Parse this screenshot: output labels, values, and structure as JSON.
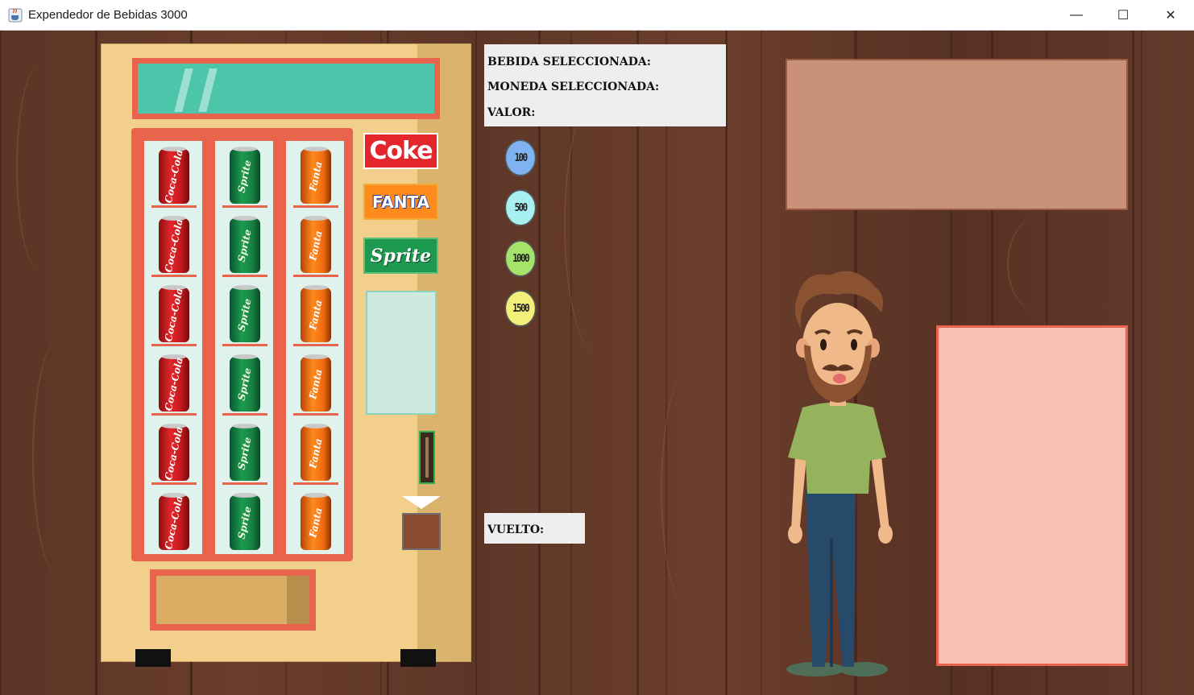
{
  "window": {
    "title": "Expendedor de Bebidas 3000",
    "controls": {
      "minimize": "—",
      "maximize": "☐",
      "close": "✕"
    }
  },
  "machine": {
    "columns": [
      {
        "brand": "coke",
        "can_label": "Coca-Cola",
        "count": 6
      },
      {
        "brand": "sprite",
        "can_label": "Sprite",
        "count": 6
      },
      {
        "brand": "fanta",
        "can_label": "Fanta",
        "count": 6
      }
    ],
    "brand_buttons": [
      {
        "key": "coke",
        "label": "Coke"
      },
      {
        "key": "fanta",
        "label": "FANTA"
      },
      {
        "key": "sprite",
        "label": "Sprite"
      }
    ]
  },
  "info": {
    "bebida_label": "BEBIDA SELECCIONADA:",
    "moneda_label": "MONEDA SELECCIONADA:",
    "valor_label": "VALOR:",
    "vuelto_label": "VUELTO:"
  },
  "coins": [
    {
      "label": "100",
      "color": "#7fb2f0"
    },
    {
      "label": "500",
      "color": "#a8f0f0"
    },
    {
      "label": "1000",
      "color": "#a6e36a"
    },
    {
      "label": "1500",
      "color": "#f3f07a"
    }
  ],
  "colors": {
    "machine_body": "#f2cf8b",
    "machine_accent": "#e8644d",
    "display": "#4dc5aa",
    "panel_top": "#c89178",
    "panel_bottom": "#f8bfb2"
  }
}
